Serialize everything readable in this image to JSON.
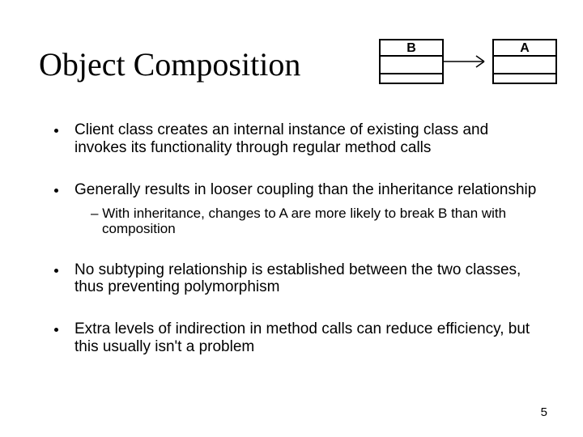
{
  "title": "Object Composition",
  "diagram": {
    "box_b_label": "B",
    "box_a_label": "A"
  },
  "bullets": {
    "b1": "Client class creates an internal instance of existing class and invokes its functionality through regular method calls",
    "b2": "Generally results in looser coupling than the inheritance relationship",
    "b2_sub1": "With inheritance, changes to A are more likely to break B than with composition",
    "b3": "No subtyping relationship is established between the two classes, thus preventing polymorphism",
    "b4": "Extra levels of indirection in method calls can reduce efficiency, but this usually isn't a problem"
  },
  "page_number": "5"
}
